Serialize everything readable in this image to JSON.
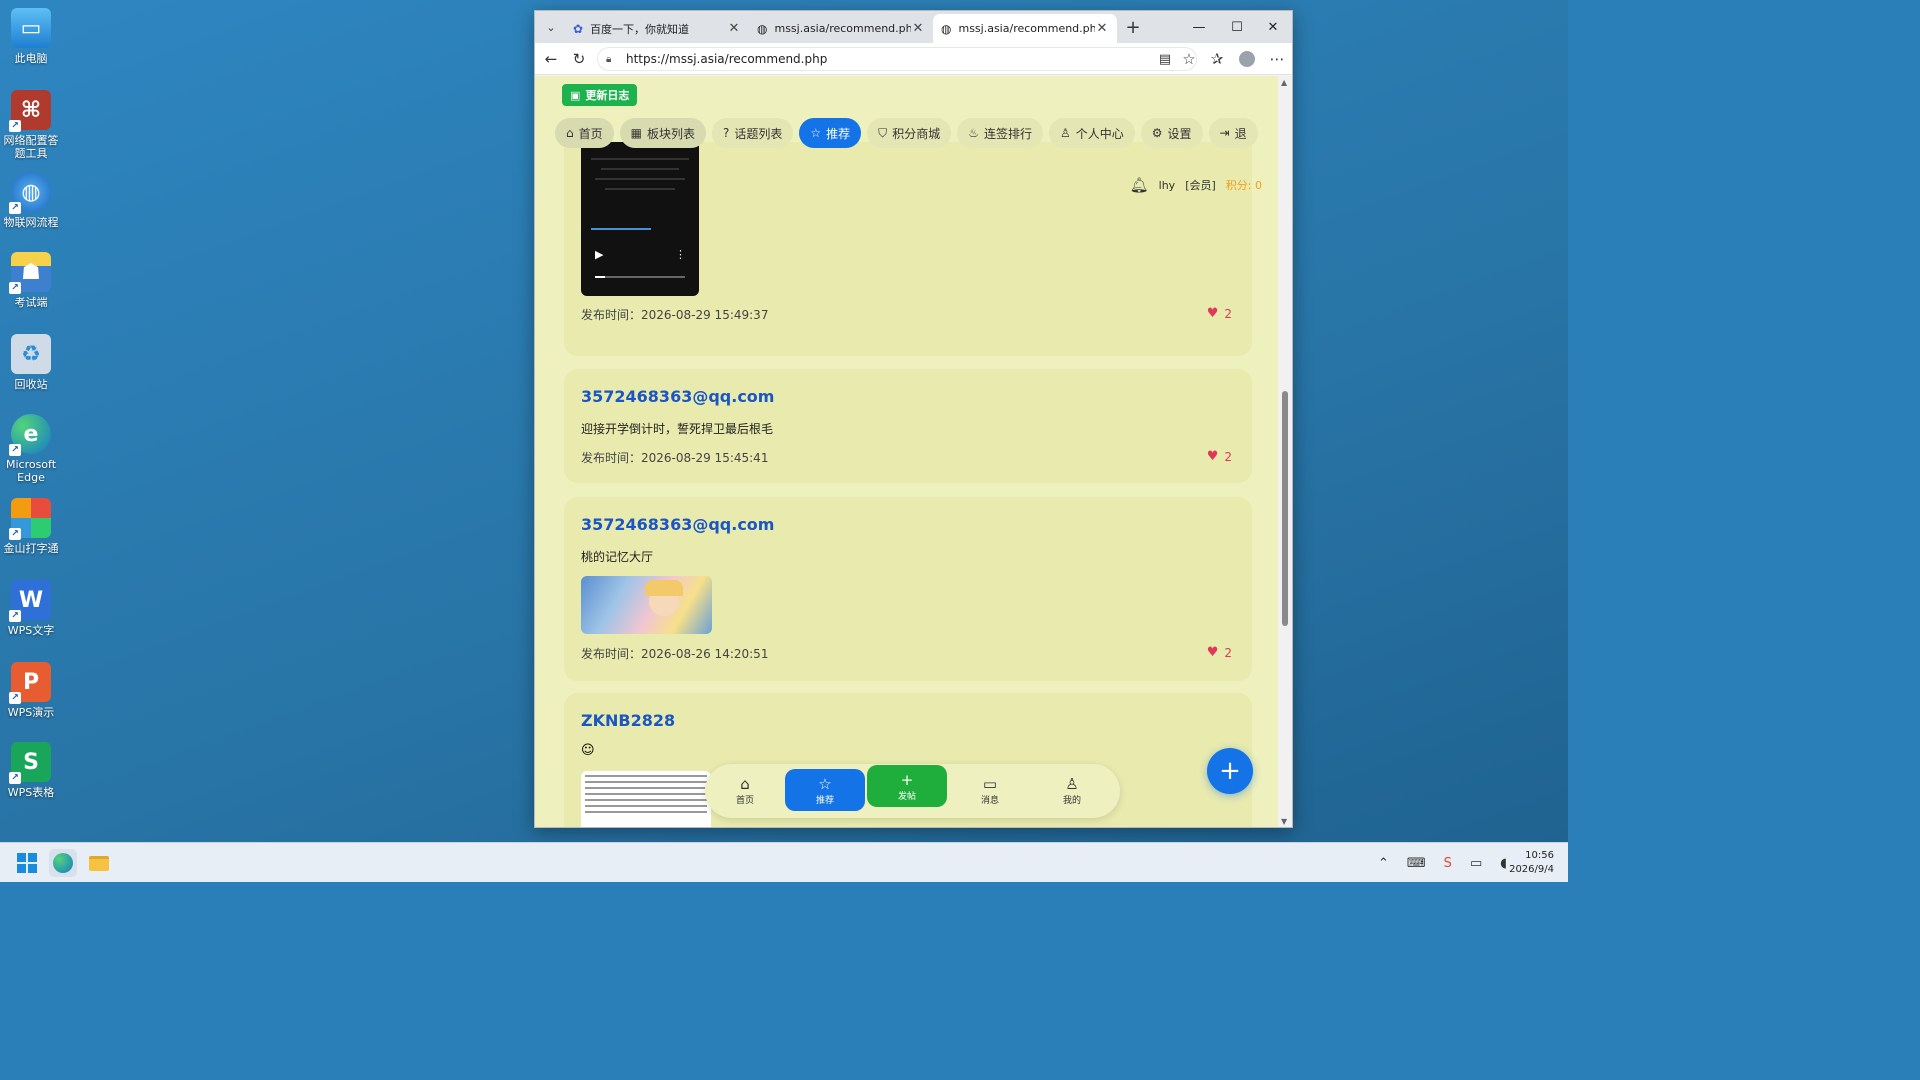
{
  "desktop": {
    "icons": [
      {
        "label": "此电脑",
        "icon": "monitor-icon",
        "color": "#2b8fd6"
      },
      {
        "label": "网络配置答题工具",
        "icon": "network-tool-icon",
        "color": "#c0392b"
      },
      {
        "label": "物联网流程",
        "icon": "globe-icon",
        "color": "#1e88e5"
      },
      {
        "label": "考试端",
        "icon": "reader-icon",
        "color": "#3f7fd0"
      },
      {
        "label": "回收站",
        "icon": "recycle-bin-icon",
        "color": "#9fb3c8"
      },
      {
        "label": "Microsoft Edge",
        "icon": "edge-icon",
        "color": "#1c9a6c"
      },
      {
        "label": "金山打字通",
        "icon": "typing-icon",
        "color": "#e67e22"
      },
      {
        "label": "WPS文字",
        "icon": "wps-writer-icon",
        "color": "#2f6fd8"
      },
      {
        "label": "WPS演示",
        "icon": "wps-presentation-icon",
        "color": "#e85c32"
      },
      {
        "label": "WPS表格",
        "icon": "wps-spreadsheet-icon",
        "color": "#1aa65a"
      }
    ]
  },
  "browser": {
    "tabs": [
      {
        "title": "百度一下，你就知道",
        "icon": "baidu-paw-icon",
        "active": false
      },
      {
        "title": "mssj.asia/recommend.php",
        "icon": "globe-icon",
        "active": false
      },
      {
        "title": "mssj.asia/recommend.php",
        "icon": "globe-icon",
        "active": true
      }
    ],
    "new_tab": "+",
    "url": "https://mssj.asia/recommend.php"
  },
  "site": {
    "changelog_label": "更新日志",
    "nav": [
      {
        "label": "首页",
        "icon": "home-icon",
        "glyph": "⌂"
      },
      {
        "label": "板块列表",
        "icon": "grid-icon",
        "glyph": "▦"
      },
      {
        "label": "话题列表",
        "icon": "question-icon",
        "glyph": "?"
      },
      {
        "label": "推荐",
        "icon": "star-icon",
        "glyph": "☆"
      },
      {
        "label": "积分商城",
        "icon": "bag-icon",
        "glyph": "⛉"
      },
      {
        "label": "连签排行",
        "icon": "fire-icon",
        "glyph": "♨"
      },
      {
        "label": "个人中心",
        "icon": "user-icon",
        "glyph": "♙"
      },
      {
        "label": "设置",
        "icon": "gear-icon",
        "glyph": "⚙"
      },
      {
        "label": "退",
        "icon": "logout-icon",
        "glyph": "⇥"
      }
    ],
    "active_nav": "推荐",
    "user": {
      "name": "lhy",
      "role": "[会员]",
      "points": "积分: 0"
    },
    "posts": [
      {
        "author": "",
        "text": "",
        "time": "发布时间：2026-08-29 15:49:37",
        "likes": "2",
        "media": "video"
      },
      {
        "author": "3572468363@qq.com",
        "text": "迎接开学倒计时，誓死捍卫最后根毛",
        "time": "发布时间：2026-08-29 15:45:41",
        "likes": "2",
        "media": "none"
      },
      {
        "author": "3572468363@qq.com",
        "text": "桃的记忆大厅",
        "time": "发布时间：2026-08-26 14:20:51",
        "likes": "2",
        "media": "image"
      },
      {
        "author": "ZKNB2828",
        "text": "",
        "time": "",
        "likes": "",
        "media": "text-image"
      }
    ],
    "bottom_nav": [
      {
        "label": "首页",
        "icon": "home-icon",
        "glyph": "⌂"
      },
      {
        "label": "推荐",
        "icon": "star-icon",
        "glyph": "☆"
      },
      {
        "label": "发帖",
        "icon": "plus-icon",
        "glyph": "+"
      },
      {
        "label": "消息",
        "icon": "chat-icon",
        "glyph": "▭"
      },
      {
        "label": "我的",
        "icon": "user-icon",
        "glyph": "♙"
      }
    ],
    "fab_label": "+"
  },
  "taskbar": {
    "time": "10:56",
    "date": "2026/9/4"
  },
  "colors": {
    "accent": "#1473e6",
    "post_green": "#1fae3c",
    "page_bg": "#eef0bd",
    "card_bg": "#e8eaae",
    "author_blue": "#1a56c4",
    "like_red": "#e0385a",
    "points_orange": "#f0a020"
  }
}
